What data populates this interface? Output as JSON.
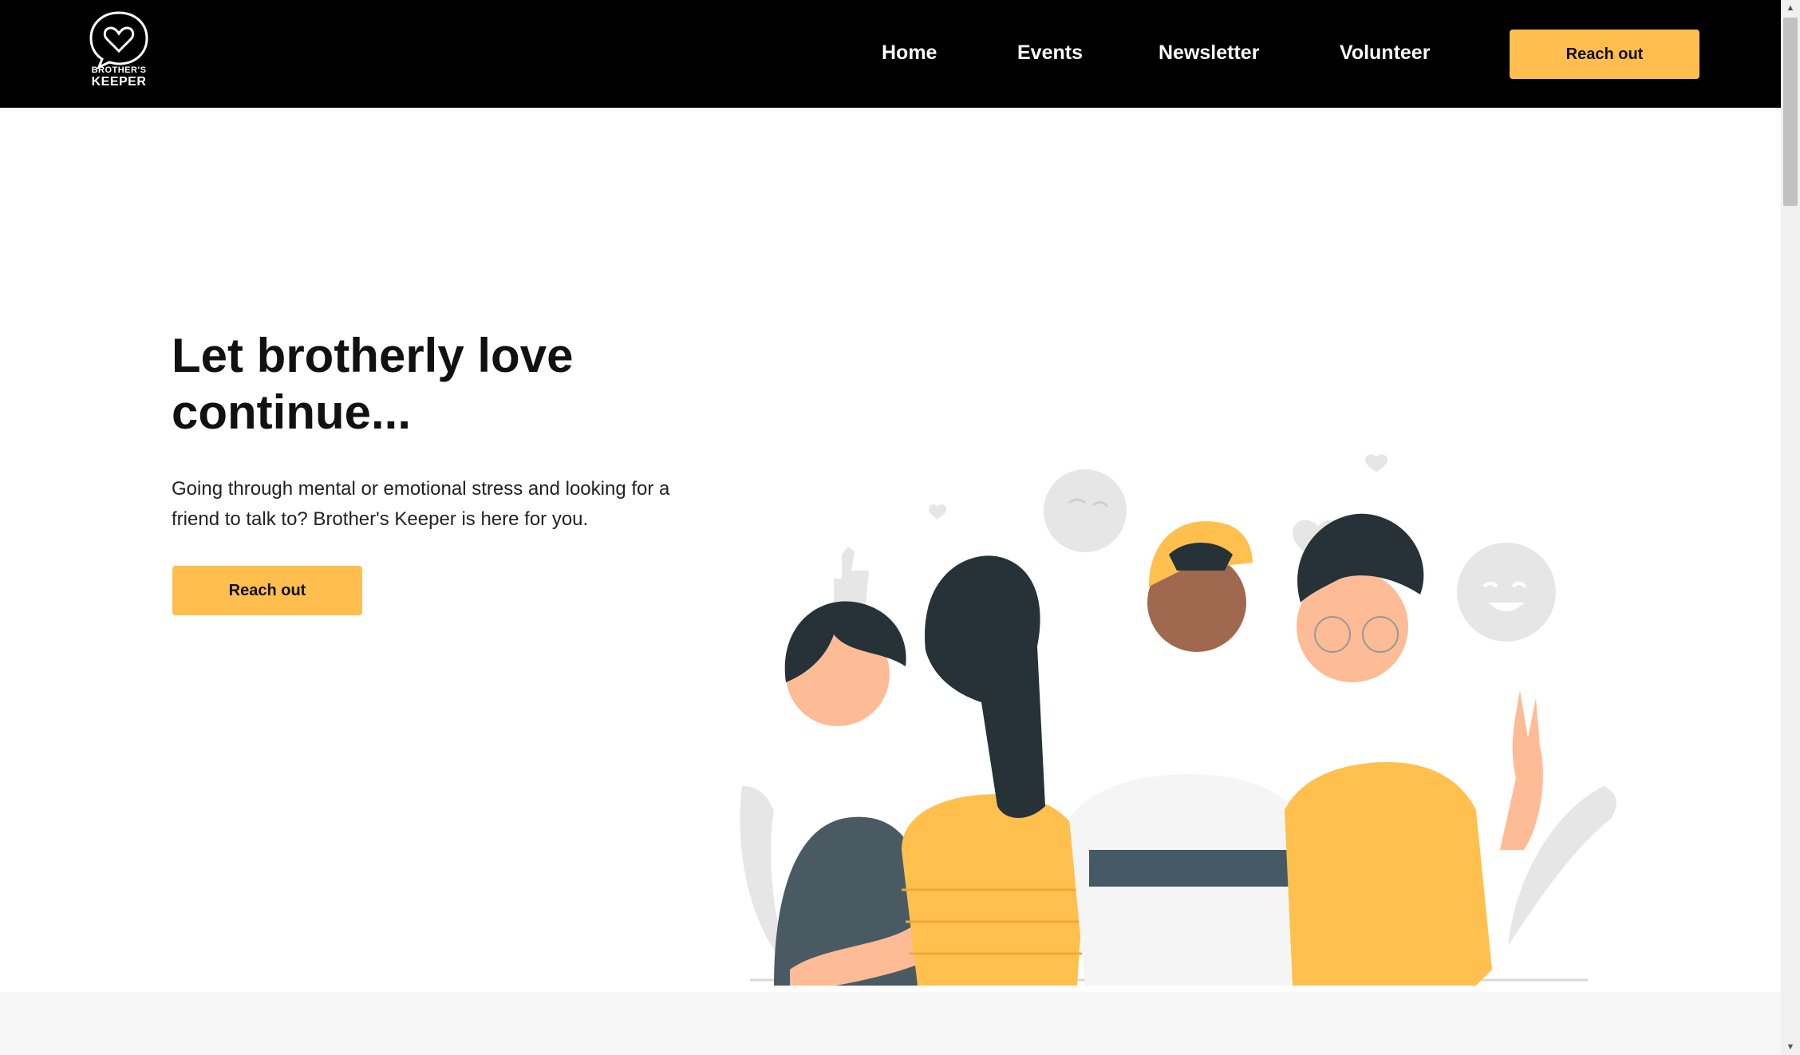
{
  "header": {
    "logo": {
      "icon": "heart-speech-bubble-icon",
      "line1": "BROTHER'S",
      "line2": "KEEPER"
    },
    "nav": [
      {
        "label": "Home"
      },
      {
        "label": "Events"
      },
      {
        "label": "Newsletter"
      },
      {
        "label": "Volunteer"
      }
    ],
    "cta_label": "Reach out"
  },
  "hero": {
    "title_line1": "Let brotherly love",
    "title_line2": "continue...",
    "subtitle_line1": "Going through mental or emotional stress and looking for a",
    "subtitle_line2": "friend to talk to? Brother's Keeper is here for you.",
    "cta_label": "Reach out"
  },
  "colors": {
    "accent": "#FFBE4D",
    "header_bg": "#000000",
    "page_bg": "#FFFFFF"
  }
}
